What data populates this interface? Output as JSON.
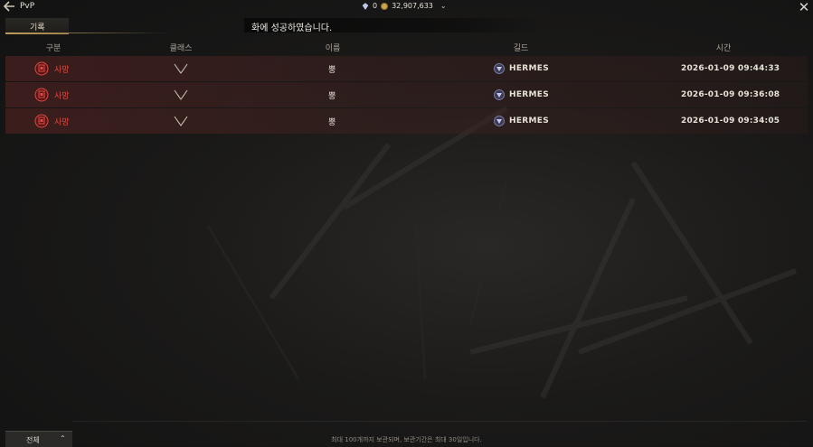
{
  "header": {
    "title": "PvP",
    "gems": "0",
    "gold": "32,907,633"
  },
  "tabs": {
    "active_label": "기록"
  },
  "toast": {
    "message": "화에 성공하였습니다."
  },
  "columns": [
    "구분",
    "클래스",
    "이름",
    "길드",
    "시간"
  ],
  "records": [
    {
      "type": "사망",
      "class_icon": "wing-class-icon",
      "name": "뿡",
      "guild": "HERMES",
      "time": "2026-01-09 09:44:33"
    },
    {
      "type": "사망",
      "class_icon": "wing-class-icon",
      "name": "뿡",
      "guild": "HERMES",
      "time": "2026-01-09 09:36:08"
    },
    {
      "type": "사망",
      "class_icon": "wing-class-icon",
      "name": "뿡",
      "guild": "HERMES",
      "time": "2026-01-09 09:34:05"
    }
  ],
  "footer": {
    "filter_label": "전체",
    "note": "최대 100개까지 보관되며, 보관기간은 최대 30일입니다."
  },
  "colors": {
    "death": "#e04a44",
    "accent_gold": "#c9a56a",
    "row_bg": "#5a2422"
  }
}
